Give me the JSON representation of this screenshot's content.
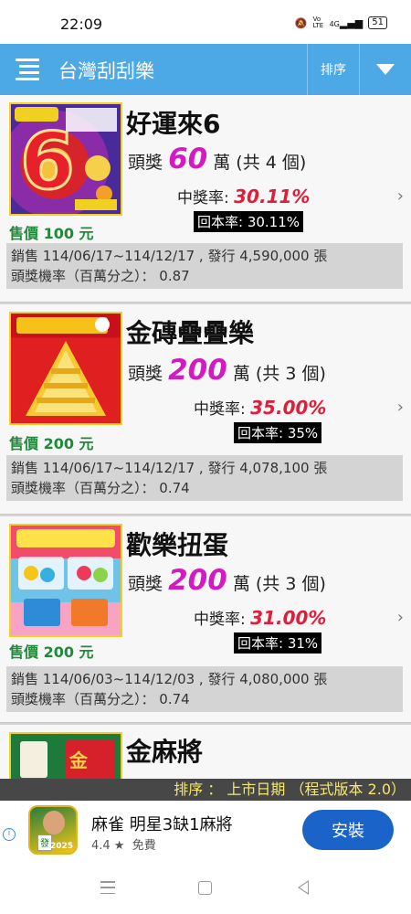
{
  "status_bar": {
    "time": "22:09",
    "network": "4G",
    "battery": "51",
    "volte": "Vo LTE"
  },
  "app": {
    "title": "台灣刮刮樂",
    "sort_label": "排序"
  },
  "colors": {
    "appbar": "#4da9e6",
    "price_green": "#1e8a3a",
    "prize_magenta": "#d21bc3",
    "rate_red": "#e01e3a",
    "status_yellow": "#f5e86a",
    "install_blue": "#1a63c9"
  },
  "tickets": [
    {
      "name": "好運來6",
      "prize_prefix": "頭獎",
      "prize_amount": "60",
      "prize_suffix": "萬 (共 4 個)",
      "win_label": "中獎率:",
      "win_rate": "30.11%",
      "rtp": "回本率: 30.11%",
      "price": "售價 100 元",
      "sales": "銷售 114/06/17~114/12/17 , 發行 4,590,000 張",
      "odds": "頭獎機率（百萬分之）： 0.87",
      "thumb_icon": "lucky-6-ticket-image"
    },
    {
      "name": "金磚疊疊樂",
      "prize_prefix": "頭獎",
      "prize_amount": "200",
      "prize_suffix": "萬 (共 3 個)",
      "win_label": "中獎率:",
      "win_rate": "35.00%",
      "rtp": "回本率: 35%",
      "price": "售價 200 元",
      "sales": "銷售 114/06/17~114/12/17 , 發行 4,078,100 張",
      "odds": "頭獎機率（百萬分之）： 0.74",
      "thumb_icon": "gold-bricks-ticket-image"
    },
    {
      "name": "歡樂扭蛋",
      "prize_prefix": "頭獎",
      "prize_amount": "200",
      "prize_suffix": "萬 (共 3 個)",
      "win_label": "中獎率:",
      "win_rate": "31.00%",
      "rtp": "回本率: 31%",
      "price": "售價 200 元",
      "sales": "銷售 114/06/03~114/12/03 , 發行 4,080,000 張",
      "odds": "頭獎機率（百萬分之）： 0.74",
      "thumb_icon": "gachapon-ticket-image"
    },
    {
      "name": "金麻將",
      "thumb_icon": "mahjong-ticket-image"
    }
  ],
  "bottom_status": "排序 ： 上市日期 （程式版本 2.0）",
  "ad": {
    "title": "麻雀 明星3缺1麻將",
    "rating": "4.4 ★",
    "price": "免費",
    "install_label": "安裝",
    "icon_tile": "發",
    "icon_year": "2025"
  }
}
